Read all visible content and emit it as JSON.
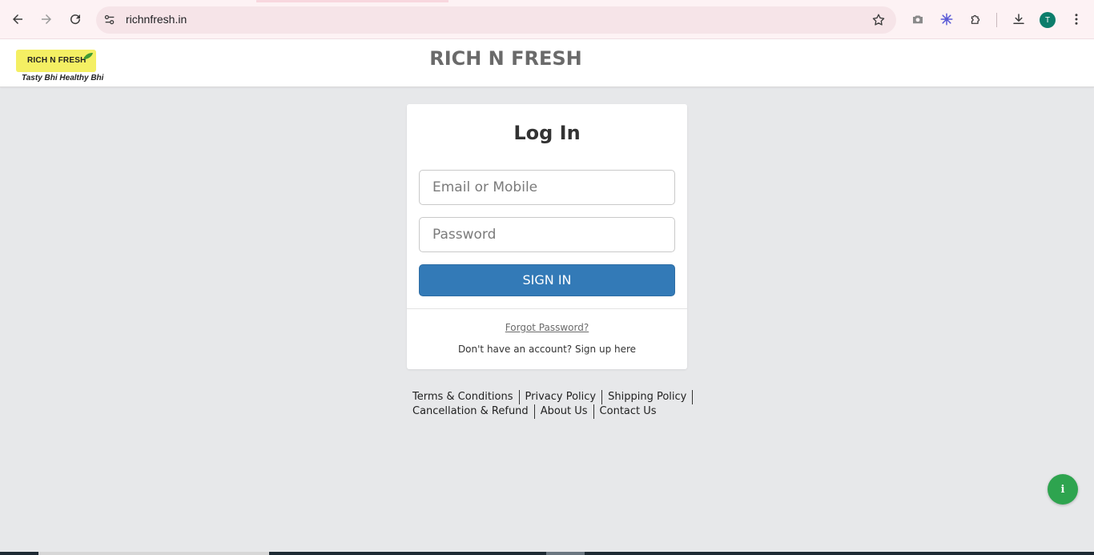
{
  "browser": {
    "url": "richnfresh.in",
    "profile_initial": "T",
    "icons": {
      "back": "back-arrow-icon",
      "forward": "forward-arrow-icon",
      "reload": "reload-icon",
      "site_info": "site-settings-icon",
      "bookmark": "star-icon",
      "screenshot": "camera-icon",
      "extension_app": "snowflake-icon",
      "extensions": "puzzle-icon",
      "downloads": "download-icon",
      "menu": "kebab-menu-icon"
    }
  },
  "header": {
    "logo_text": "RICH N FRESH",
    "logo_tagline": "Tasty Bhi Healthy Bhi",
    "title": "RICH N FRESH"
  },
  "login": {
    "title": "Log In",
    "email_placeholder": "Email or Mobile",
    "email_value": "",
    "password_placeholder": "Password",
    "password_value": "",
    "signin_label": "SIGN IN",
    "forgot_label": "Forgot Password?",
    "signup_prefix": "Don't have an account?",
    "signup_link": "Sign up here"
  },
  "footer": {
    "row1": [
      "Terms & Conditions",
      "Privacy Policy",
      "Shipping Policy"
    ],
    "row2": [
      "Cancellation & Refund",
      "About Us",
      "Contact Us"
    ]
  },
  "fab": {
    "label": "i",
    "icon": "info-icon"
  },
  "colors": {
    "primary": "#337ab7",
    "background": "#e7e8ea",
    "fab": "#2ea44f",
    "logo_badge": "#f4ef63"
  }
}
